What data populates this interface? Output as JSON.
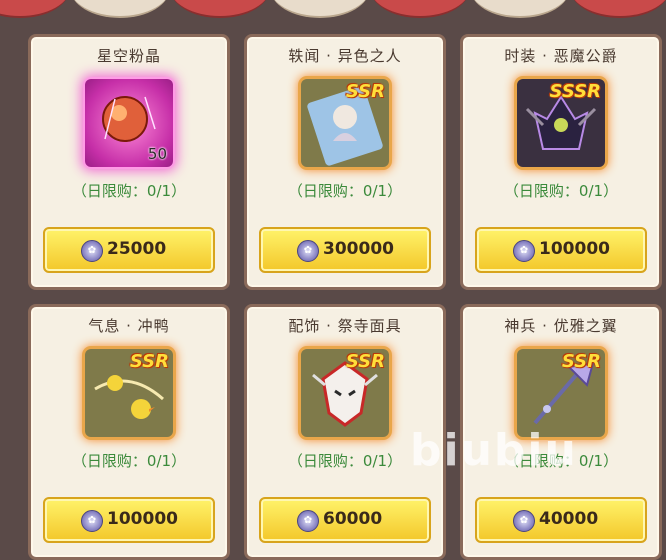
{
  "shop": {
    "items": [
      {
        "name": "星空粉晶",
        "rarity": "",
        "count": "50",
        "limit": "（日限购：0/1）",
        "price": "25000"
      },
      {
        "name": "轶闻 · 异色之人",
        "rarity": "SSR",
        "count": "",
        "limit": "（日限购：0/1）",
        "price": "300000"
      },
      {
        "name": "时装 · 恶魔公爵",
        "rarity": "SSSR",
        "count": "",
        "limit": "（日限购：0/1）",
        "price": "100000"
      },
      {
        "name": "气息 · 冲鸭",
        "rarity": "SSR",
        "count": "",
        "limit": "（日限购：0/1）",
        "price": "100000"
      },
      {
        "name": "配饰 · 祭寺面具",
        "rarity": "SSR",
        "count": "",
        "limit": "（日限购：0/1）",
        "price": "60000"
      },
      {
        "name": "神兵 · 优雅之翼",
        "rarity": "SSR",
        "count": "",
        "limit": "（日限购：0/1）",
        "price": "40000"
      }
    ],
    "currency_icon": "silver-coin-icon",
    "watermark": "biubiu"
  },
  "colors": {
    "accent": "#f3c72a",
    "limit_text": "#3b8a3b",
    "awning_red": "#c94a4a"
  }
}
